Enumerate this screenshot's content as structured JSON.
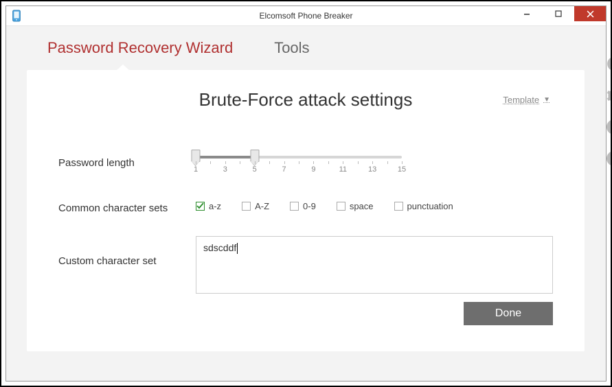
{
  "window": {
    "title": "Elcomsoft Phone Breaker"
  },
  "tabs": {
    "recovery": "Password Recovery Wizard",
    "tools": "Tools"
  },
  "card": {
    "title": "Brute-Force attack settings",
    "template_label": "Template"
  },
  "form": {
    "password_length_label": "Password length",
    "common_sets_label": "Common character sets",
    "custom_set_label": "Custom character set",
    "slider": {
      "min": 1,
      "max": 15,
      "low": 1,
      "high": 5,
      "visible_labels": [
        "1",
        "3",
        "5",
        "7",
        "9",
        "11",
        "13",
        "15"
      ]
    },
    "sets": {
      "az": {
        "label": "a-z",
        "checked": true
      },
      "AZ": {
        "label": "A-Z",
        "checked": false
      },
      "digits": {
        "label": "0-9",
        "checked": false
      },
      "space": {
        "label": "space",
        "checked": false
      },
      "punct": {
        "label": "punctuation",
        "checked": false
      }
    },
    "custom_value": "sdscddf"
  },
  "buttons": {
    "done": "Done"
  },
  "rail": {
    "clock": "history-icon",
    "gear": "settings-icon",
    "help": "help-icon",
    "info": "info-icon"
  }
}
